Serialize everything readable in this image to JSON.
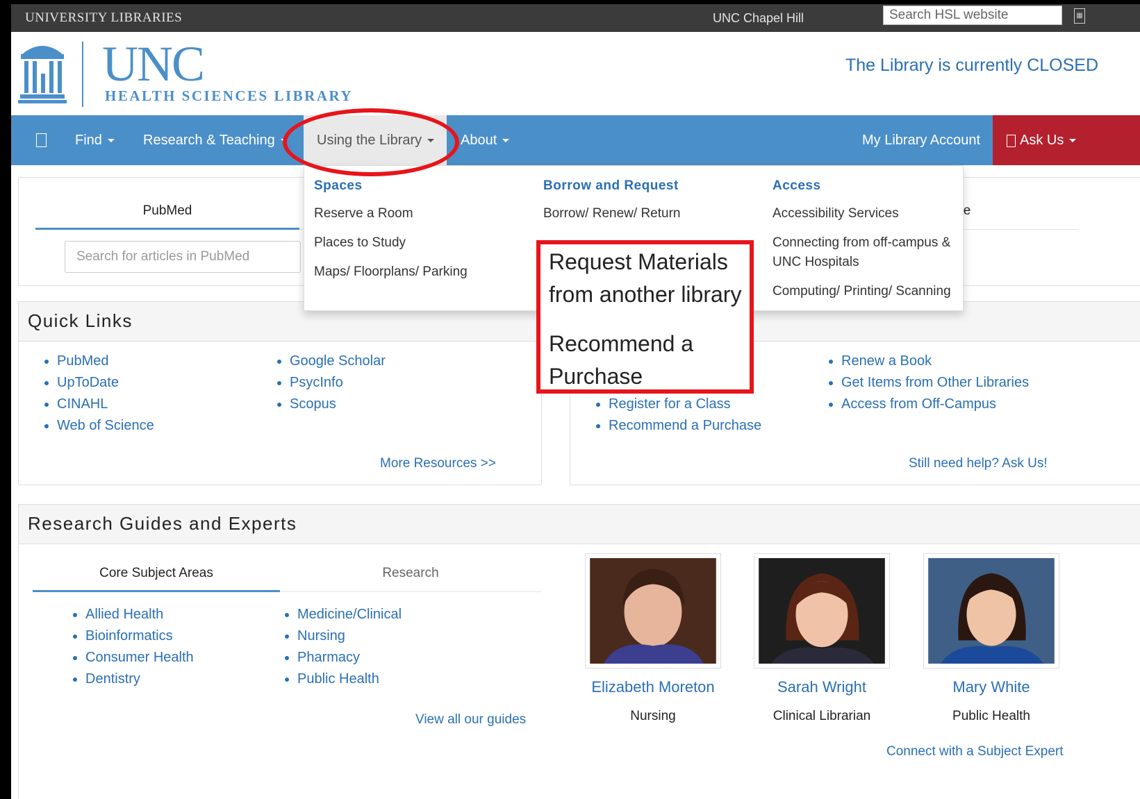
{
  "utility_bar": {
    "title": "UNIVERSITY LIBRARIES",
    "campus_link": "UNC Chapel Hill",
    "search_placeholder": "Search HSL website"
  },
  "header": {
    "logo_main": "UNC",
    "logo_sub": "HEALTH SCIENCES LIBRARY",
    "status": "The Library is currently CLOSED"
  },
  "nav": {
    "items": [
      "Find",
      "Research & Teaching",
      "Using the Library",
      "About"
    ],
    "account": "My Library Account",
    "ask": "Ask Us"
  },
  "search_tabs": {
    "active_tab": "PubMed",
    "hidden_tab_fragment": "e",
    "placeholder": "Search for articles in PubMed"
  },
  "dropdown": {
    "columns": [
      {
        "heading": "Spaces",
        "items": [
          "Reserve a Room",
          "Places to Study",
          "Maps/ Floorplans/ Parking"
        ]
      },
      {
        "heading": "Borrow and Request",
        "items": [
          "Borrow/ Renew/ Return"
        ]
      },
      {
        "heading": "Access",
        "items": [
          "Accessibility Services",
          "Connecting from off-campus &",
          "UNC Hospitals",
          "Computing/ Printing/ Scanning"
        ]
      }
    ]
  },
  "annotation": {
    "line1": "Request Materials",
    "line2": "from another library",
    "line3": "Recommend a",
    "line4": "Purchase"
  },
  "quick_links": {
    "title": "Quick Links",
    "col1": [
      "PubMed",
      "UpToDate",
      "CINAHL",
      "Web of Science"
    ],
    "col2": [
      "Google Scholar",
      "PsycInfo",
      "Scopus"
    ],
    "more": "More Resources >>"
  },
  "services": {
    "col1": [
      "Register for a Class",
      "Recommend a Purchase"
    ],
    "col2": [
      "Renew a Book",
      "Get Items from Other Libraries",
      "Access from Off-Campus"
    ],
    "help": "Still need help? Ask Us!"
  },
  "guides": {
    "title": "Research Guides and Experts",
    "tabs": [
      "Core Subject Areas",
      "Research"
    ],
    "col1": [
      "Allied Health",
      "Bioinformatics",
      "Consumer Health",
      "Dentistry"
    ],
    "col2": [
      "Medicine/Clinical",
      "Nursing",
      "Pharmacy",
      "Public Health"
    ],
    "view_all": "View all our guides",
    "experts": [
      {
        "name": "Elizabeth Moreton",
        "role": "Nursing"
      },
      {
        "name": "Sarah Wright",
        "role": "Clinical Librarian"
      },
      {
        "name": "Mary White",
        "role": "Public Health"
      }
    ],
    "connect": "Connect with a Subject Expert"
  },
  "colors": {
    "brand_blue": "#4b8fc9",
    "link_blue": "#2a6fb5",
    "ask_red": "#b5202e",
    "annotation_red": "#e8141b"
  }
}
